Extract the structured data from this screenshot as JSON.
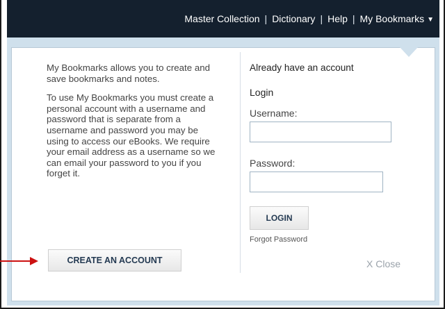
{
  "nav": {
    "items": [
      "Master Collection",
      "Dictionary",
      "Help",
      "My Bookmarks"
    ],
    "separator": "|",
    "dropdown_icon": "chevron-down-icon"
  },
  "left": {
    "intro": "My Bookmarks allows you to create and save bookmarks and notes.",
    "details": "To use My Bookmarks you must create a personal account with a username and password that is separate from a username and password you may be using to access our eBooks. We require your email address as a username so we can email your password to you if you forget it.",
    "create_button": "CREATE AN ACCOUNT"
  },
  "right": {
    "account_text": "Already have an account",
    "login_title": "Login",
    "username_label": "Username:",
    "username_value": "",
    "password_label": "Password:",
    "password_value": "",
    "login_button": "LOGIN",
    "forgot_link": "Forgot Password",
    "close_label": "X Close"
  },
  "colors": {
    "topbar": "#14202e",
    "panel_border": "#cfe0ec",
    "arrow": "#cc1111"
  }
}
